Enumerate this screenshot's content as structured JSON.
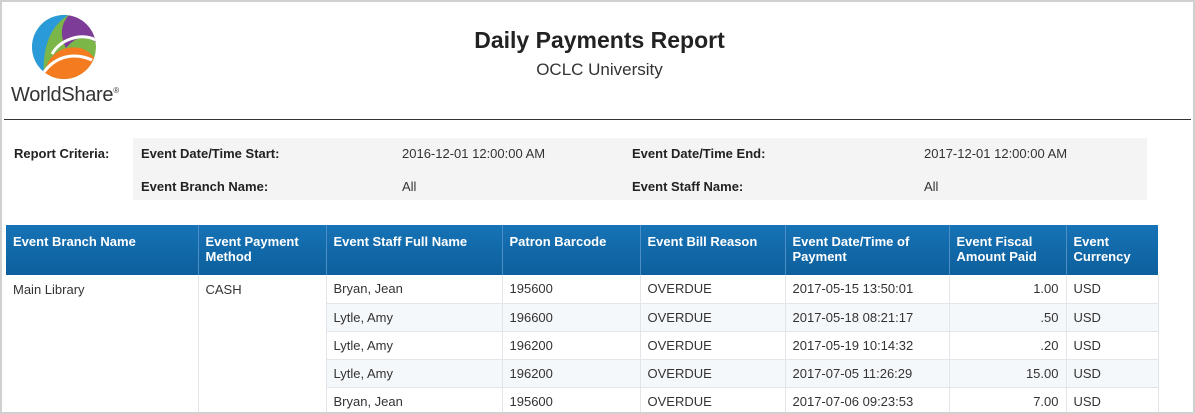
{
  "header": {
    "logo_text": "WorldShare",
    "logo_mark": "®",
    "title": "Daily Payments Report",
    "subtitle": "OCLC University"
  },
  "criteria": {
    "section_label": "Report Criteria:",
    "start_label": "Event Date/Time Start:",
    "start_value": "2016-12-01 12:00:00 AM",
    "end_label": "Event Date/Time End:",
    "end_value": "2017-12-01 12:00:00 AM",
    "branch_label": "Event Branch Name:",
    "branch_value": "All",
    "staff_label": "Event Staff Name:",
    "staff_value": "All"
  },
  "colors": {
    "header_blue": "#1673b6",
    "logo_blue": "#2a9bd8",
    "logo_orange": "#f47b20",
    "logo_green": "#7ab648",
    "logo_purple": "#7d3c98"
  },
  "table": {
    "columns": [
      {
        "line1": "Event Branch Name",
        "line2": ""
      },
      {
        "line1": "Event Payment",
        "line2": "Method"
      },
      {
        "line1": "Event Staff Full Name",
        "line2": ""
      },
      {
        "line1": "Patron Barcode",
        "line2": ""
      },
      {
        "line1": "Event Bill Reason",
        "line2": ""
      },
      {
        "line1": "Event Date/Time of",
        "line2": "Payment"
      },
      {
        "line1": "Event Fiscal",
        "line2": "Amount Paid"
      },
      {
        "line1": "Event",
        "line2": "Currency"
      }
    ],
    "group": {
      "branch": "Main Library",
      "method": "CASH"
    },
    "rows": [
      {
        "staff": "Bryan, Jean",
        "barcode": "195600",
        "reason": "OVERDUE",
        "datetime": "2017-05-15 13:50:01",
        "amount": "1.00",
        "currency": "USD"
      },
      {
        "staff": "Lytle, Amy",
        "barcode": "196600",
        "reason": "OVERDUE",
        "datetime": "2017-05-18 08:21:17",
        "amount": ".50",
        "currency": "USD"
      },
      {
        "staff": "Lytle, Amy",
        "barcode": "196200",
        "reason": "OVERDUE",
        "datetime": "2017-05-19 10:14:32",
        "amount": ".20",
        "currency": "USD"
      },
      {
        "staff": "Lytle, Amy",
        "barcode": "196200",
        "reason": "OVERDUE",
        "datetime": "2017-07-05 11:26:29",
        "amount": "15.00",
        "currency": "USD"
      },
      {
        "staff": "Bryan, Jean",
        "barcode": "195600",
        "reason": "OVERDUE",
        "datetime": "2017-07-06 09:23:53",
        "amount": "7.00",
        "currency": "USD"
      }
    ]
  }
}
